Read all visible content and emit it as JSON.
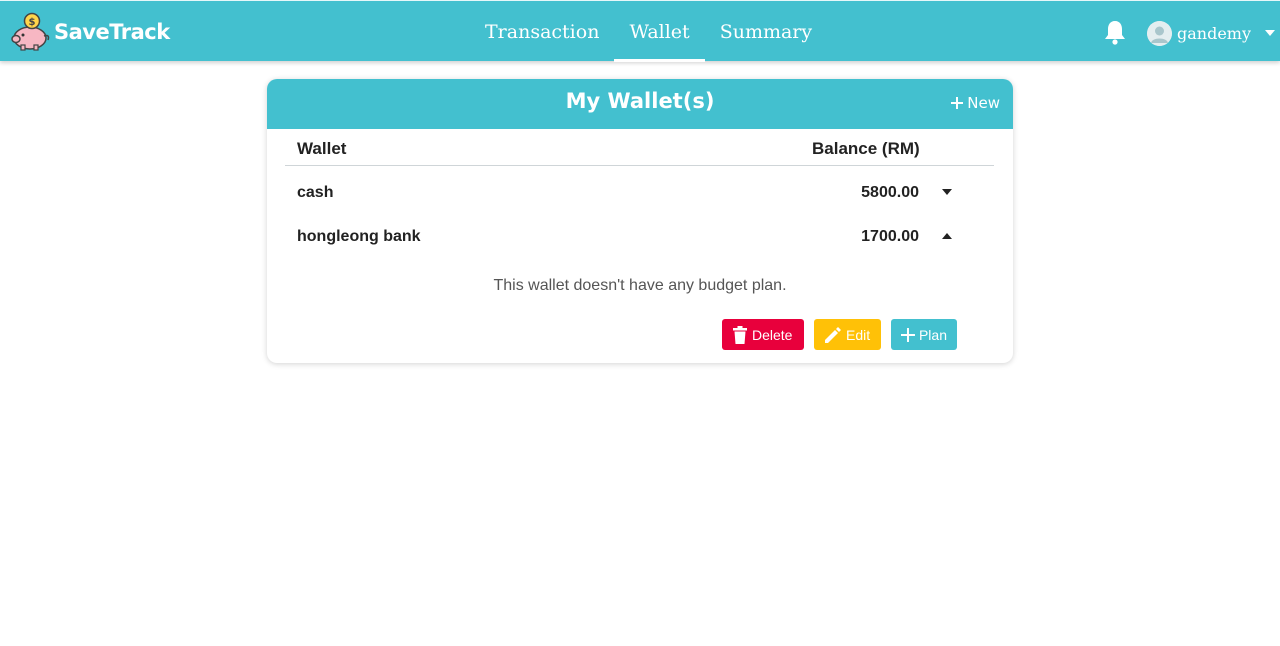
{
  "header": {
    "app_name": "SaveTrack",
    "tabs": [
      {
        "label": "Transaction",
        "active": false
      },
      {
        "label": "Wallet",
        "active": true
      },
      {
        "label": "Summary",
        "active": false
      }
    ],
    "username": "gandemy",
    "icons": {
      "logo": "piggy-bank-icon",
      "notifications": "bell-icon",
      "user": "user-avatar-icon",
      "menu": "caret-down-icon"
    }
  },
  "wallet_card": {
    "title": "My Wallet(s)",
    "new_label": "New",
    "columns": [
      "Wallet",
      "Balance (RM)"
    ],
    "rows": [
      {
        "name": "cash",
        "balance": "5800.00",
        "expanded": false
      },
      {
        "name": "hongleong bank",
        "balance": "1700.00",
        "expanded": true
      }
    ],
    "expanded_detail": {
      "message": "This wallet doesn't have any budget plan.",
      "buttons": {
        "delete": "Delete",
        "edit": "Edit",
        "plan": "Plan"
      }
    }
  },
  "colors": {
    "accent": "#43c0cf",
    "delete": "#e8003c",
    "edit": "#ffc107",
    "plan": "#43c0cf"
  }
}
